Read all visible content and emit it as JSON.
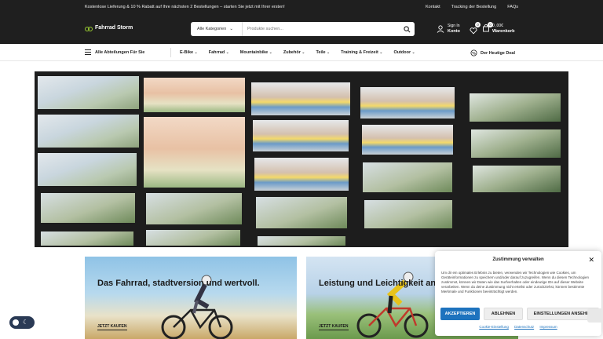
{
  "topbar": {
    "promo": "Kostenlose Lieferung & 10 % Rabatt auf Ihre nächsten 2 Bestellungen – starten Sie jetzt mit Ihrer ersten!",
    "links": [
      "Kontakt",
      "Tracking der Bestellung",
      "FAQs"
    ]
  },
  "header": {
    "logo": "Fahrrad Storm",
    "search_category": "Alle Kategorien",
    "search_placeholder": "Produkte suchen...",
    "account_small": "Sign In",
    "account_label": "Konto",
    "wishlist_count": "0",
    "cart_count": "0",
    "cart_total": "0 ,00€",
    "cart_label": "Warenkorb"
  },
  "nav": {
    "all_departments": "Alle Abteilungen Für Sie",
    "items": [
      "E-Bike",
      "Fahrrad",
      "Mountainbike",
      "Zubehör",
      "Teile",
      "Training & Freizeit",
      "Outdoor"
    ],
    "deal": "Der Heutige Deal"
  },
  "cards": [
    {
      "title": "Das Fahrrad, stadtversion und wertvoll.",
      "cta": "JETZT KAUFEN"
    },
    {
      "title": "Leistung und Leichtigkeit an jeder Kurve.",
      "cta": "JETZT KAUFEN"
    }
  ],
  "cookie": {
    "title": "Zustimmung verwalten",
    "body": "Um dir ein optimales Erlebnis zu bieten, verwenden wir Technologien wie Cookies, um Geräteinformationen zu speichern und/oder darauf zuzugreifen. Wenn du diesen Technologien zustimmst, können wir Daten wie das Surfverhalten oder eindeutige IDs auf dieser Website verarbeiten. Wenn du deine Zustimmung nicht erteilst oder zurückziehst, können bestimmte Merkmale und Funktionen beeinträchtigt werden.",
    "accept": "AKZEPTIEREN",
    "decline": "ABLEHNEN",
    "settings": "EINSTELLUNGEN ANSEHEN",
    "links": [
      "Cookie-Einstellung",
      "Datenschutz",
      "Impressum"
    ]
  },
  "colors": {
    "header_bg": "#1f1f1f",
    "accent": "#1e73be",
    "logo_green": "#9acd32"
  }
}
